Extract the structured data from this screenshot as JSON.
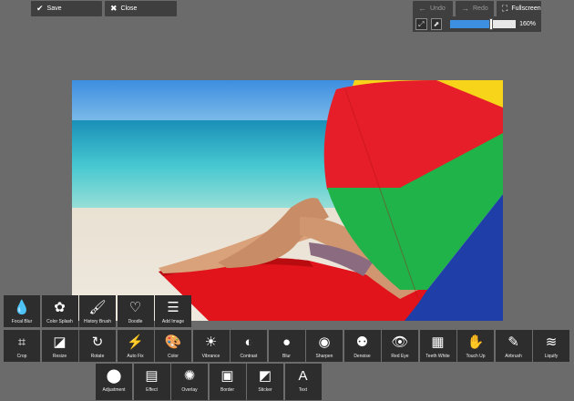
{
  "toolbar": {
    "save_label": "Save",
    "close_label": "Close",
    "undo_label": "Undo",
    "redo_label": "Redo",
    "fullscreen_label": "Fullscreen"
  },
  "zoom": {
    "value": 0.6,
    "label": "160%"
  },
  "photo": {
    "description_icon": "beach-umbrella-photo"
  },
  "tools": {
    "row1": [
      {
        "name": "focal-blur",
        "label": "Focal Blur",
        "icon": "droplets-icon"
      },
      {
        "name": "color-splash",
        "label": "Color Splash",
        "icon": "flower-icon"
      },
      {
        "name": "history-brush",
        "label": "History Brush",
        "icon": "brush-icon"
      },
      {
        "name": "doodle",
        "label": "Doodle",
        "icon": "doodle-icon"
      },
      {
        "name": "add-image",
        "label": "Add Image",
        "icon": "layers-icon"
      }
    ],
    "row2": [
      {
        "name": "crop",
        "label": "Crop",
        "icon": "crop-icon"
      },
      {
        "name": "resize",
        "label": "Resize",
        "icon": "resize-icon"
      },
      {
        "name": "rotate",
        "label": "Rotate",
        "icon": "rotate-icon"
      },
      {
        "name": "auto-fix",
        "label": "Auto Fix",
        "icon": "auto-fix-icon"
      },
      {
        "name": "color",
        "label": "Color",
        "icon": "palette-icon"
      },
      {
        "name": "vibrance",
        "label": "Vibrance",
        "icon": "sun-icon"
      },
      {
        "name": "contrast",
        "label": "Contrast",
        "icon": "contrast-icon"
      },
      {
        "name": "blur",
        "label": "Blur",
        "icon": "blur-icon"
      },
      {
        "name": "sharpen",
        "label": "Sharpen",
        "icon": "sharpen-icon"
      },
      {
        "name": "denoise",
        "label": "Denoise",
        "icon": "denoise-icon"
      },
      {
        "name": "red-eye",
        "label": "Red Eye",
        "icon": "eye-icon"
      },
      {
        "name": "teeth-white",
        "label": "Teeth White",
        "icon": "teeth-icon"
      },
      {
        "name": "touch-up",
        "label": "Touch Up",
        "icon": "touch-up-icon"
      },
      {
        "name": "airbrush",
        "label": "Airbrush",
        "icon": "airbrush-icon"
      },
      {
        "name": "liquify",
        "label": "Liquify",
        "icon": "waves-icon"
      }
    ],
    "row3": [
      {
        "name": "adjustment",
        "label": "Adjustment",
        "icon": "adjustment-icon"
      },
      {
        "name": "effect",
        "label": "Effect",
        "icon": "film-icon"
      },
      {
        "name": "overlay",
        "label": "Overlay",
        "icon": "bulb-icon"
      },
      {
        "name": "border",
        "label": "Border",
        "icon": "frame-icon"
      },
      {
        "name": "sticker",
        "label": "Sticker",
        "icon": "sticker-icon"
      },
      {
        "name": "text",
        "label": "Text",
        "icon": "text-icon"
      }
    ]
  },
  "colors": {
    "background": "#6b6b6b",
    "button": "#3f3f3f",
    "tool": "#2d2d2d",
    "zoom_fill": "#3d8fe0"
  }
}
